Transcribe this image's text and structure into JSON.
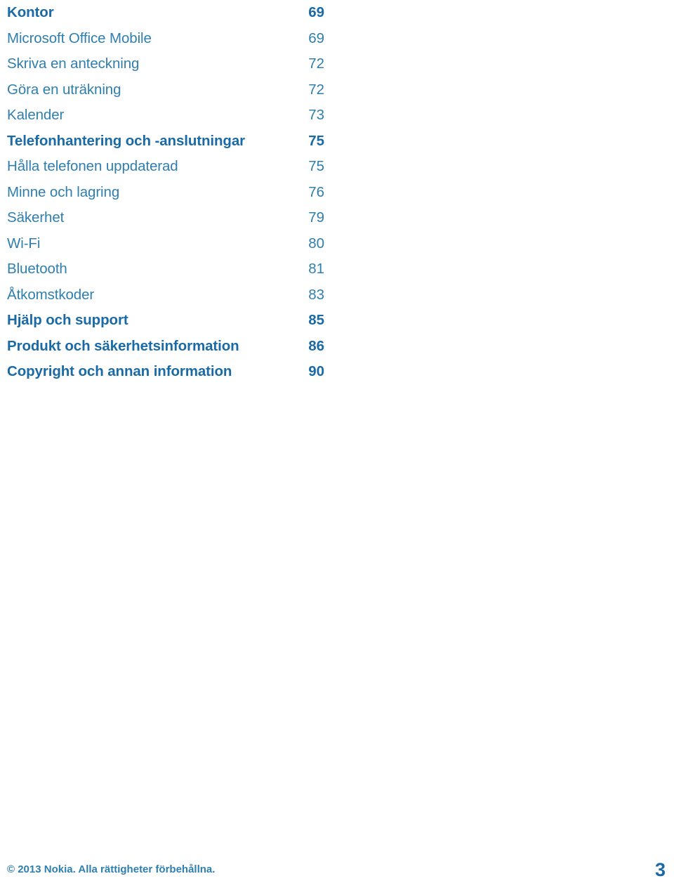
{
  "document": {
    "type": "table-of-contents",
    "language": "sv",
    "background_color": "#ffffff",
    "chapter_color": "#1a6aa6",
    "topic_color": "#2f7fae"
  },
  "toc": {
    "entries": [
      {
        "label": "Kontor",
        "page": "69",
        "level": "chapter"
      },
      {
        "label": "Microsoft Office Mobile",
        "page": "69",
        "level": "topic"
      },
      {
        "label": "Skriva en anteckning",
        "page": "72",
        "level": "topic"
      },
      {
        "label": "Göra en uträkning",
        "page": "72",
        "level": "topic"
      },
      {
        "label": "Kalender",
        "page": "73",
        "level": "topic"
      },
      {
        "label": "Telefonhantering och -anslutningar",
        "page": "75",
        "level": "chapter"
      },
      {
        "label": "Hålla telefonen uppdaterad",
        "page": "75",
        "level": "topic"
      },
      {
        "label": "Minne och lagring",
        "page": "76",
        "level": "topic"
      },
      {
        "label": "Säkerhet",
        "page": "79",
        "level": "topic"
      },
      {
        "label": "Wi-Fi",
        "page": "80",
        "level": "topic"
      },
      {
        "label": "Bluetooth",
        "page": "81",
        "level": "topic"
      },
      {
        "label": "Åtkomstkoder",
        "page": "83",
        "level": "topic"
      },
      {
        "label": "Hjälp och support",
        "page": "85",
        "level": "chapter"
      },
      {
        "label": "Produkt och säkerhetsinformation",
        "page": "86",
        "level": "chapter"
      },
      {
        "label": "Copyright och annan information",
        "page": "90",
        "level": "chapter"
      }
    ]
  },
  "footer": {
    "copyright": "© 2013 Nokia. Alla rättigheter förbehållna.",
    "page_number": "3"
  }
}
